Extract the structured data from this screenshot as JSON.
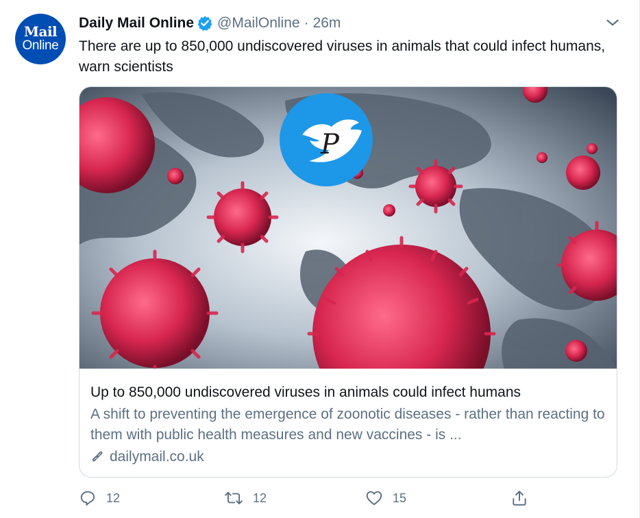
{
  "tweet": {
    "avatar": {
      "line1": "Mail",
      "line2": "Online",
      "bg": "#004db3"
    },
    "author_name": "Daily Mail Online",
    "handle": "@MailOnline",
    "separator": "·",
    "time": "26m",
    "text": "There are up to 850,000 undiscovered viruses in animals that could infect humans, warn scientists",
    "verified_icon": "verified-badge-icon",
    "menu_icon": "chevron-down-icon"
  },
  "card": {
    "image_description_icon": "virus-world-map-image",
    "title": "Up to 850,000 undiscovered viruses in animals could infect humans",
    "description": "A shift to preventing the emergence of zoonotic diseases - rather than reacting to them with public health measures and new vaccines - is ...",
    "link": "dailymail.co.uk",
    "link_icon": "link-icon"
  },
  "actions": {
    "reply_count": "12",
    "retweet_count": "12",
    "like_count": "15",
    "share_icon": "share-icon"
  },
  "colors": {
    "accent": "#1da1f2",
    "muted": "#5b7083",
    "border": "#cfd9de",
    "virus": "#d7264f"
  }
}
